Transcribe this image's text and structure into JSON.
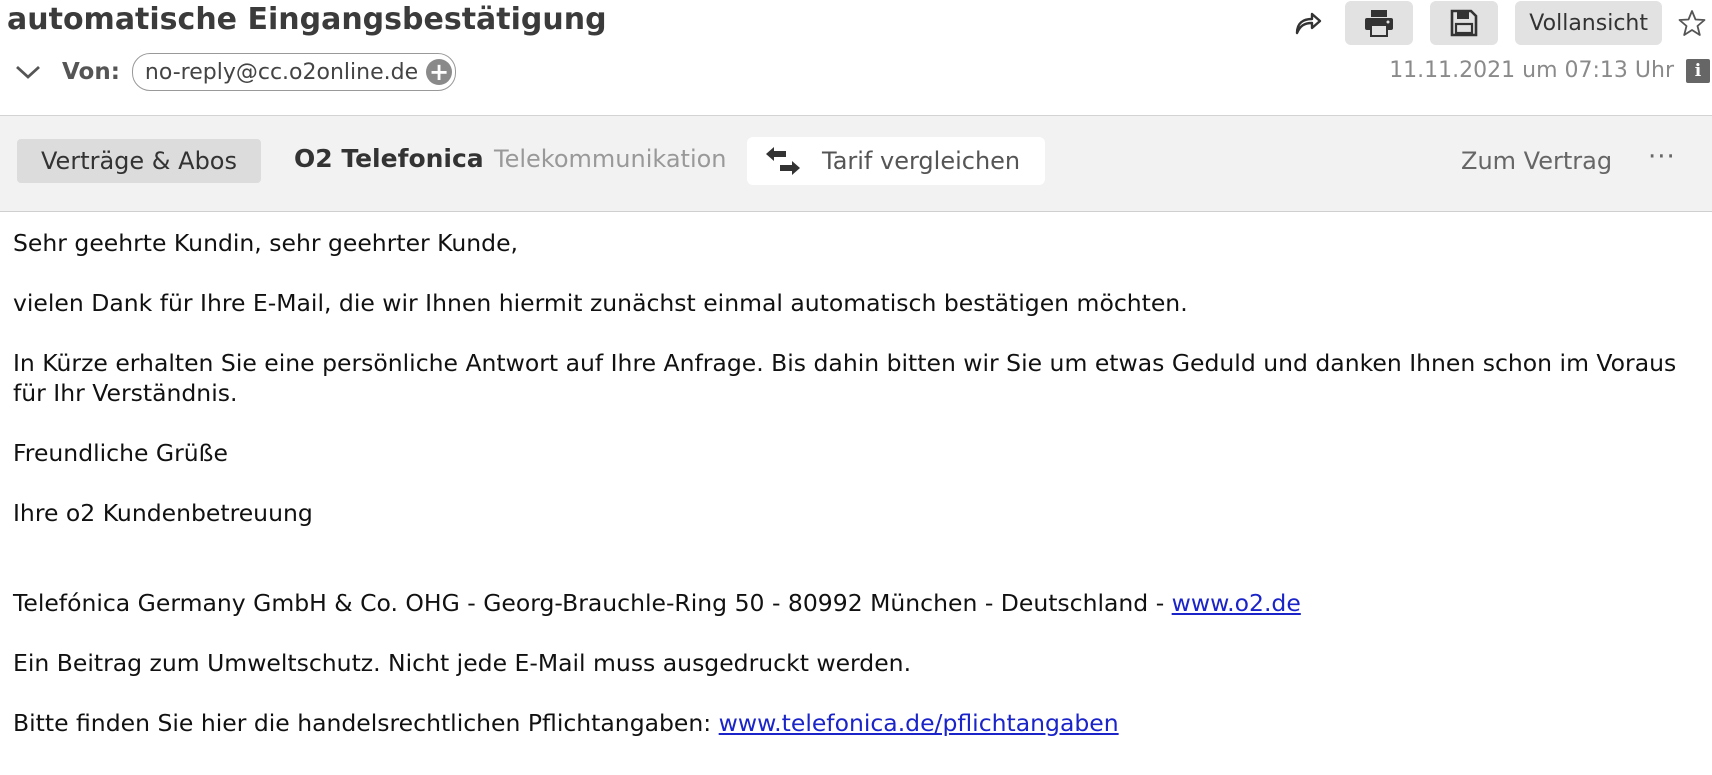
{
  "email": {
    "subject": "automatische Eingangsbestätigung",
    "from_label": "Von:",
    "from_address": "no-reply@cc.o2online.de",
    "date": "11.11.2021 um 07:13 Uhr"
  },
  "toolbar": {
    "forward_icon": "forward-icon",
    "print_icon": "print-icon",
    "save_icon": "save-icon",
    "fullview_label": "Vollansicht",
    "star_icon": "star-icon",
    "info_icon_text": "i"
  },
  "contract_bar": {
    "category_label": "Verträge & Abos",
    "company": "O2 Telefonica",
    "industry": "Telekommunikation",
    "compare_label": "Tarif vergleichen",
    "contract_link": "Zum Vertrag",
    "more_label": "···"
  },
  "body": {
    "greeting": "Sehr geehrte Kundin, sehr geehrter Kunde,",
    "p1": "vielen Dank für Ihre E-Mail, die wir Ihnen hiermit zunächst einmal automatisch bestätigen möchten.",
    "p2": "In Kürze erhalten Sie eine persönliche Antwort auf Ihre Anfrage. Bis dahin bitten wir Sie um etwas Geduld und danken Ihnen schon im Voraus für Ihr Verständnis.",
    "closing": "Freundliche Grüße",
    "signature": "Ihre o2 Kundenbetreuung",
    "footer_address": "Telefónica Germany GmbH & Co. OHG - Georg-Brauchle-Ring 50 - 80992 München - Deutschland - ",
    "footer_link": "www.o2.de",
    "footer_env": "Ein Beitrag zum Umweltschutz. Nicht jede E-Mail muss ausgedruckt werden.",
    "footer_legal": "Bitte finden Sie hier die handelsrechtlichen Pflichtangaben: ",
    "footer_legal_link": "www.telefonica.de/pflichtangaben"
  },
  "colors": {
    "link": "#1a24c8",
    "button_bg": "#e2e2e2",
    "bar_bg": "#f2f2f2"
  }
}
